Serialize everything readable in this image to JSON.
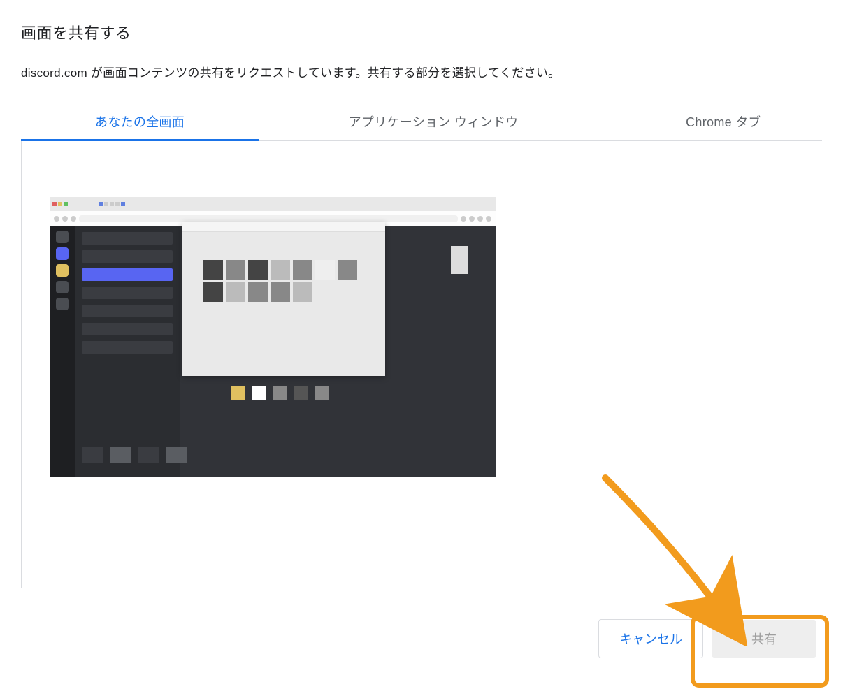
{
  "dialog": {
    "title": "画面を共有する",
    "description": "discord.com が画面コンテンツの共有をリクエストしています。共有する部分を選択してください。",
    "requesting_site": "discord.com"
  },
  "tabs": [
    {
      "label": "あなたの全画面",
      "active": true
    },
    {
      "label": "アプリケーション ウィンドウ",
      "active": false
    },
    {
      "label": "Chrome タブ",
      "active": false
    }
  ],
  "buttons": {
    "cancel": "キャンセル",
    "share": "共有"
  },
  "annotation": {
    "highlight_target": "share-button",
    "arrow_color": "#f29b1d"
  },
  "colors": {
    "accent": "#1a73e8",
    "border": "#dadce0",
    "text": "#202124",
    "muted": "#5f6368",
    "annotation": "#f29b1d"
  }
}
